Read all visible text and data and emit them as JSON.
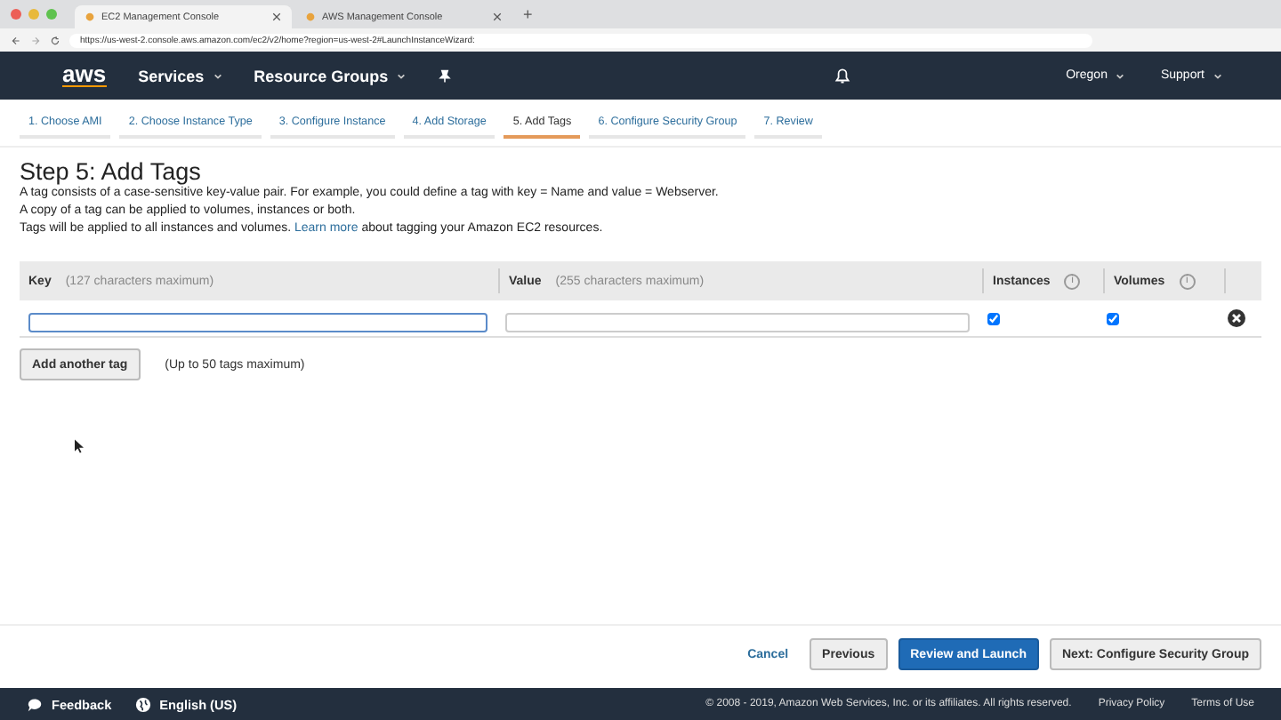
{
  "browser": {
    "tabs": [
      {
        "title": "EC2 Management Console",
        "selected": true
      },
      {
        "title": "AWS Management Console",
        "selected": false
      }
    ],
    "new_tab": "+",
    "url": "https://us-west-2.console.aws.amazon.com/ec2/v2/home?region=us-west-2#LaunchInstanceWizard:"
  },
  "navbar": {
    "logo": "aws",
    "menus": [
      "Services",
      "Resource Groups"
    ],
    "region": "Oregon",
    "support": "Support"
  },
  "steps": [
    {
      "label": "1. Choose AMI",
      "selected": false
    },
    {
      "label": "2. Choose Instance Type",
      "selected": false
    },
    {
      "label": "3. Configure Instance",
      "selected": false
    },
    {
      "label": "4. Add Storage",
      "selected": false
    },
    {
      "label": "5. Add Tags",
      "selected": true
    },
    {
      "label": "6. Configure Security Group",
      "selected": false
    },
    {
      "label": "7. Review",
      "selected": false
    }
  ],
  "heading": "Step 5: Add Tags",
  "intro": [
    "A tag consists of a case-sensitive key-value pair. For example, you could define a tag with key = Name and value = Webserver.",
    "A copy of a tag can be applied to volumes, instances or both."
  ],
  "intro_link_line": {
    "before": "Tags will be applied to all instances and volumes.",
    "link": "Learn more",
    "after": "about tagging your Amazon EC2 resources."
  },
  "table": {
    "columns": [
      {
        "label": "Key",
        "hint": "(127 characters maximum)"
      },
      {
        "label": "Value",
        "hint": "(255 characters maximum)"
      },
      {
        "label": "Instances",
        "info": "i"
      },
      {
        "label": "Volumes",
        "info": "i"
      }
    ],
    "rows": [
      {
        "key": "",
        "value": "",
        "instances": true,
        "volumes": true
      }
    ]
  },
  "add_button": "Add another tag",
  "add_note": "(Up to 50 tags maximum)",
  "actions": {
    "cancel": "Cancel",
    "previous": "Previous",
    "review": "Review and Launch",
    "next": "Next: Configure Security Group"
  },
  "footer": {
    "feedback": "Feedback",
    "language": "English (US)",
    "copyright": "© 2008 - 2019, Amazon Web Services, Inc. or its affiliates. All rights reserved.",
    "links": [
      "Privacy Policy",
      "Terms of Use"
    ]
  }
}
